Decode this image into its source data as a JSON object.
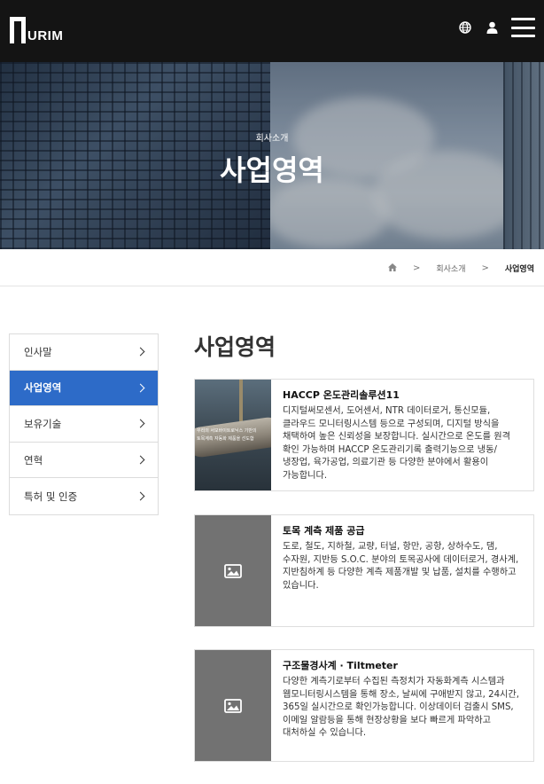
{
  "header": {
    "logo_text": "URIM",
    "icons": [
      "globe-icon",
      "user-icon",
      "hamburger-menu-icon"
    ]
  },
  "hero": {
    "subtitle": "회사소개",
    "title": "사업영역"
  },
  "breadcrumb": {
    "home_icon": "home-icon",
    "sep": ">",
    "items": [
      "회사소개",
      "사업영역"
    ]
  },
  "sidebar": {
    "items": [
      {
        "label": "인사말",
        "active": false
      },
      {
        "label": "사업영역",
        "active": true
      },
      {
        "label": "보유기술",
        "active": false
      },
      {
        "label": "연혁",
        "active": false
      },
      {
        "label": "특허 및 인증",
        "active": false
      }
    ]
  },
  "main": {
    "title": "사업영역",
    "cards": [
      {
        "title": "HACCP 온도관리솔루션11",
        "text": "디지털써모센서, 도어센서, NTR 데이터로거, 통신모듈, 클라우드 모니터링시스템 등으로 구성되며, 디지털 방식을 채택하여 높은 신뢰성을 보장합니다. 실시간으로 온도를 원격 확인 가능하며 HACCP 온도관리기록 출력기능으로 냉동/냉장업, 육가공업, 의료기관 등 다양한 분야에서 활용이 가능합니다.",
        "thumb_caption_1": "우리의 서모바이트로닉스 기반의",
        "thumb_caption_2": "토목계측 자동화 제품을 선도합"
      },
      {
        "title": "토목 계측 제품 공급",
        "text": "도로, 철도, 지하철, 교량, 터널, 항만, 공항, 상하수도, 댐, 수자원, 지반등 S.O.C. 분야의 토목공사에 데이터로거, 경사계, 지반침하계 등 다양한 계측 제품개발 및 납품, 설치를 수행하고 있습니다.",
        "thumb_icon": "image-placeholder-icon"
      },
      {
        "title": "구조물경사계 · Tiltmeter",
        "text": "다양한 계측기로부터 수집된 측정치가 자동화계측 시스템과 웹모니터링시스템을 통해 장소, 날씨에 구애받지 않고, 24시간, 365일 실시간으로 확인가능합니다. 이상데이터 검출시 SMS, 이메일 알람등을 통해 현장상황을 보다 빠르게 파악하고 대처하실 수 있습니다.",
        "thumb_icon": "image-placeholder-icon"
      }
    ]
  },
  "colors": {
    "header_bg": "#141414",
    "accent": "#2d6bc8",
    "placeholder_bg": "#727272"
  }
}
